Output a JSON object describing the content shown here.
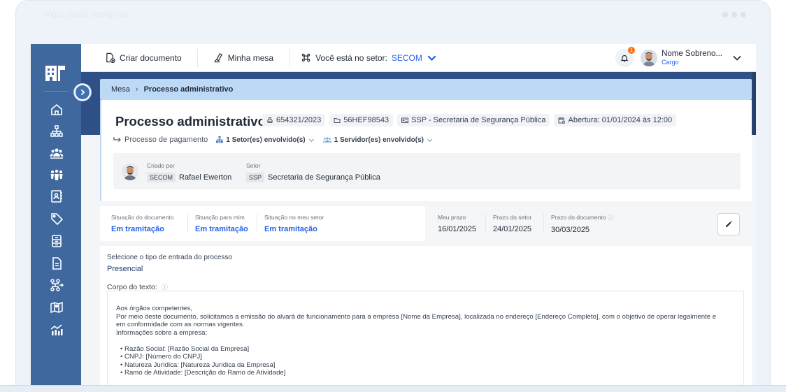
{
  "frame": {
    "title": "sogou gestão inteligente"
  },
  "topbar": {
    "create_doc": "Criar documento",
    "my_desk": "Minha mesa",
    "sector_label": "Você está no setor:",
    "sector_value": "SECOM",
    "notification_count": "1",
    "user_name": "Nome Sobreno...",
    "user_role": "Cargo"
  },
  "breadcrumb": {
    "root": "Mesa",
    "current": "Processo administrativo"
  },
  "process": {
    "title": "Processo administrativo",
    "chips": {
      "number": "654321/2023",
      "code": "56HEF98543",
      "secretariat": "SSP - Secretaria de Segurança Pública",
      "opening": "Abertura: 01/01/2024 às 12:00"
    },
    "subtype": "Processo de pagamento",
    "sectors_involved": "1 Setor(es) envolvido(s)",
    "servers_involved": "1 Servidor(es) envolvido(s)",
    "created_by_label": "Criado por",
    "created_by_tag": "SECOM",
    "created_by_name": "Rafael Ewerton",
    "sector_label": "Setor",
    "sector_tag": "SSP",
    "sector_name": "Secretaria de Segurança Pública"
  },
  "status": {
    "doc_situation_label": "Situação do documento",
    "doc_situation": "Em tramitação",
    "my_situation_label": "Situação para mim",
    "my_situation": "Em tramitação",
    "sector_situation_label": "Situação no meu setor",
    "sector_situation": "Em tramitação",
    "my_deadline_label": "Meu prazo",
    "my_deadline": "16/01/2025",
    "sector_deadline_label": "Prazo do setor",
    "sector_deadline": "24/01/2025",
    "doc_deadline_label": "Prazo do documento",
    "doc_deadline": "30/03/2025"
  },
  "form": {
    "entry_type_label": "Selecione o tipo de entrada do processo",
    "entry_type_value": "Presencial",
    "body_label": "Corpo do texto:",
    "body_lines": [
      "Aos órgãos competentes,",
      "Por meio deste documento, solicitamos a emissão do alvará de funcionamento para a empresa [Nome da Empresa], localizada no endereço [Endereço Completo], com o objetivo de operar legalmente e",
      "em conformidade com as normas vigentes.",
      "Informações sobre a empresa:"
    ],
    "body_items": [
      "• Razão Social: [Razão Social da Empresa]",
      "• CNPJ: [Número do CNPJ]",
      "• Natureza Jurídica: [Natureza Jurídica da Empresa]",
      "• Ramo de Atividade: [Descrição do Ramo de Atividade]"
    ]
  },
  "colors": {
    "sidebar": "#3f689e",
    "band": "#2f4f87",
    "breadcrumb": "#bcdaf6",
    "accent": "#2563eb"
  }
}
